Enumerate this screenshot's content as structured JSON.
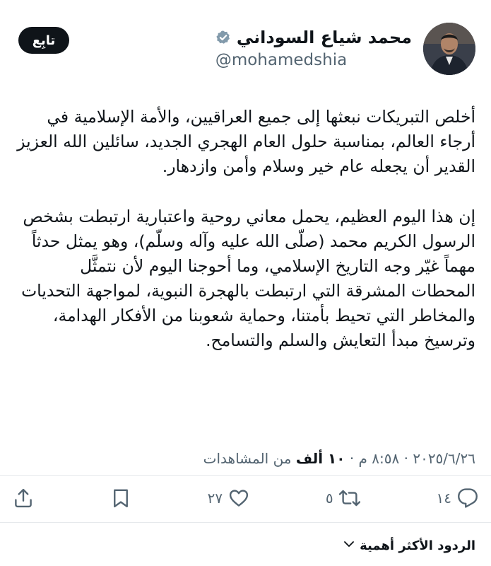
{
  "author": {
    "display_name": "محمد شياع السوداني",
    "handle": "@mohamedshia",
    "verified_icon": "verified-badge-icon"
  },
  "follow_button": {
    "label": "تابِع"
  },
  "tweet": {
    "paragraph_1": "أخلص التبريكات نبعثها إلى جميع العراقيين، والأمة الإسلامية في أرجاء العالم، بمناسبة حلول العام الهجري الجديد، سائلين الله العزيز القدير أن يجعله عام خير وسلام وأمن وازدهار.",
    "paragraph_2": "إن هذا اليوم العظيم، يحمل معاني روحية واعتبارية ارتبطت بشخص الرسول الكريم محمد (صلّى الله عليه وآله وسلّم)، وهو يمثل حدثاً مهماً غيّر وجه التاريخ الإسلامي، وما أحوجنا اليوم لأن نتمثَّل المحطات المشرقة التي ارتبطت بالهجرة النبوية، لمواجهة التحديات والمخاطر التي تحيط بأمتنا، وحماية شعوبنا من الأفكار الهدامة، وترسيخ مبدأ التعايش والسلم والتسامح."
  },
  "meta": {
    "time": "٨:٥٨ م",
    "date": "٢٠٢٥/٦/٢٦",
    "separator": "·",
    "views_count": "١٠ ألف",
    "views_label": "من المشاهدات"
  },
  "actions": {
    "reply_count": "١٤",
    "retweet_count": "٥",
    "like_count": "٢٧",
    "icons": [
      "reply-icon",
      "retweet-icon",
      "like-icon",
      "bookmark-icon",
      "share-icon"
    ]
  },
  "replies_sort": {
    "label": "الردود الأكثر أهمية",
    "icon": "chevron-down-icon"
  },
  "colors": {
    "text_primary": "#0f1419",
    "text_secondary": "#536471",
    "verified": "#829aab",
    "follow_bg": "#0f1419"
  }
}
